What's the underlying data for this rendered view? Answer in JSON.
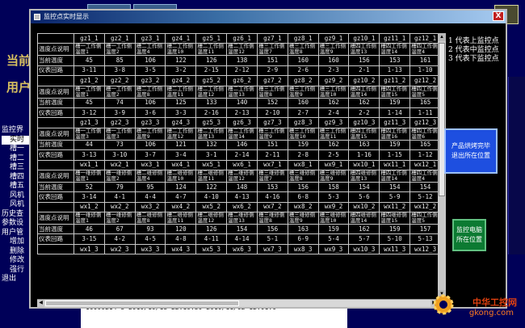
{
  "window": {
    "title": "监控点实时显示",
    "close_label": "X"
  },
  "legend": [
    "1 代表上监控点",
    "2 代表中监控点",
    "3 代表下监控点"
  ],
  "buttons": {
    "product_out": "产品烘烤完毕\n退出所在位置",
    "monitor_pc": "监控电脑\n所在位置"
  },
  "background": {
    "tree_items": [
      "监控界",
      "实时",
      "槽一",
      "槽二",
      "槽三",
      "槽四",
      "槽五",
      "风机",
      "风机",
      "历史查",
      "参数设",
      "用户管",
      "增加",
      "删除",
      "修改",
      "强行",
      "退出"
    ],
    "bottom_rows": [
      "10100103851   2010/11/04 12:01:25  2010/11/05 12:01:25",
      "10090214 8    2010/10/18 22:19:59  2010/11/02 12:01:0"
    ]
  },
  "watermark": {
    "brand": "中华工控网",
    "site": "gkong.com"
  },
  "grid": {
    "row_labels": {
      "desc": "温度点说明",
      "temp": "当前温度",
      "loop": "仪表回路"
    },
    "blocks": [
      {
        "headers": [
          "gz1_1",
          "gz2_1",
          "gz3_1",
          "gz4_1",
          "gz5_1",
          "gz6_1",
          "gz7_1",
          "gz8_1",
          "gz9_1",
          "gz10_1",
          "gz11_1",
          "gz12_1"
        ],
        "desc": [
          "槽一工作侧温度1",
          "槽一工作侧温度2",
          "槽二工作侧温度4",
          "槽二工作侧温度10",
          "槽二工作侧温度11",
          "槽二工作侧温度12",
          "槽三工作侧温度7",
          "槽三工作侧温度8",
          "槽三工作侧温度9",
          "槽四工作侧温度13",
          "槽四工作侧温度14",
          "槽四工作侧温度4"
        ],
        "temp": [
          "45",
          "85",
          "106",
          "122",
          "126",
          "138",
          "151",
          "160",
          "160",
          "156",
          "153",
          "161"
        ],
        "loop": [
          "3-11",
          "3-8",
          "3-5",
          "3-2",
          "2-15",
          "2-12",
          "2-9",
          "2-6",
          "2-3",
          "2-1",
          "1-13",
          "1-10"
        ]
      },
      {
        "headers": [
          "gz1_2",
          "gz2_2",
          "gz3_2",
          "gz4_2",
          "gz5_2",
          "gz6_2",
          "gz7_2",
          "gz8_2",
          "gz9_2",
          "gz10_2",
          "gz11_2",
          "gz12_2"
        ],
        "desc": [
          "槽一工作侧温度1",
          "槽一工作侧温度2",
          "槽二工作侧温度8",
          "槽二工作侧温度11",
          "槽二工作侧温度12",
          "槽二工作侧温度13",
          "槽三工作侧温度8",
          "槽三工作侧温度9",
          "槽三工作侧温度10",
          "槽四工作侧温度14",
          "槽四工作侧温度15",
          "槽四工作侧温度5"
        ],
        "temp": [
          "45",
          "74",
          "106",
          "125",
          "133",
          "140",
          "152",
          "160",
          "162",
          "162",
          "159",
          "165"
        ],
        "loop": [
          "3-12",
          "3-9",
          "3-6",
          "3-3",
          "2-16",
          "2-13",
          "2-10",
          "2-7",
          "2-4",
          "2-2",
          "1-14",
          "1-11"
        ]
      },
      {
        "headers": [
          "gz1_3",
          "gz2_3",
          "gz3_3",
          "gz4_3",
          "gz5_3",
          "gz6_3",
          "gz7_3",
          "gz8_3",
          "gz9_3",
          "gz10_3",
          "gz11_3",
          "gz12_3"
        ],
        "desc": [
          "槽一工作侧温度3",
          "槽一工作侧温度3",
          "槽二工作侧温度9",
          "槽二工作侧温度12",
          "槽二工作侧温度13",
          "槽二工作侧温度14",
          "槽三工作侧温度9",
          "槽三工作侧温度10",
          "槽三工作侧温度11",
          "槽四工作侧温度15",
          "槽四工作侧温度16",
          "槽四工作侧温度6"
        ],
        "temp": [
          "44",
          "73",
          "106",
          "121",
          "132",
          "146",
          "151",
          "159",
          "162",
          "163",
          "159",
          "165"
        ],
        "loop": [
          "3-13",
          "3-10",
          "3-7",
          "3-4",
          "3-1",
          "2-14",
          "2-11",
          "2-8",
          "2-5",
          "1-16",
          "1-15",
          "1-12"
        ]
      },
      {
        "headers": [
          "wx1_1",
          "wx2_1",
          "wx3_1",
          "wx4_1",
          "wx5_1",
          "wx6_1",
          "wx7_1",
          "wx8_1",
          "wx9_1",
          "wx10_1",
          "wx11_1",
          "wx12_1"
        ],
        "desc": [
          "槽一维修侧温度1",
          "槽一维修侧温度2",
          "槽二维修侧温度4",
          "槽二维修侧温度10",
          "槽二维修侧温度11",
          "槽二维修侧温度12",
          "槽三维修侧温度7",
          "槽三维修侧温度8",
          "槽三维修侧温度9",
          "槽四维修侧温度13",
          "槽四工作侧温度14",
          "槽四工作侧温度4"
        ],
        "temp": [
          "52",
          "79",
          "95",
          "124",
          "122",
          "148",
          "153",
          "156",
          "158",
          "154",
          "154",
          "154"
        ],
        "loop": [
          "3-14",
          "4-1",
          "4-4",
          "4-7",
          "4-10",
          "4-13",
          "4-16",
          "6-8",
          "5-3",
          "5-6",
          "5-9",
          "5-12"
        ]
      },
      {
        "headers": [
          "wx1_2",
          "wx2_2",
          "wx3_2",
          "wx4_2",
          "wx5_2",
          "wx6_2",
          "wx7_2",
          "wx8_2",
          "wx9_2",
          "wx10_2",
          "wx11_2",
          "wx12_2"
        ],
        "desc": [
          "槽一维修侧温度1",
          "槽一维修侧温度2",
          "槽二维修侧温度8",
          "槽二维修侧温度11",
          "槽二维修侧温度12",
          "槽二维修侧温度13",
          "槽三维修侧温度8",
          "槽三维修侧温度9",
          "槽三维修侧温度10",
          "槽四维修侧温度14",
          "槽四维修侧温度15",
          "槽四工作侧温度5"
        ],
        "temp": [
          "46",
          "67",
          "93",
          "120",
          "126",
          "154",
          "156",
          "163",
          "159",
          "162",
          "159",
          "157"
        ],
        "loop": [
          "3-15",
          "4-2",
          "4-5",
          "4-8",
          "4-11",
          "4-14",
          "5-1",
          "6-9",
          "5-4",
          "5-7",
          "5-10",
          "5-13"
        ]
      },
      {
        "headers": [
          "wx1_3",
          "wx2_3",
          "wx3_3",
          "wx4_3",
          "wx5_3",
          "wx6_3",
          "wx7_3",
          "wx8_3",
          "wx9_3",
          "wx10_3",
          "wx11_3",
          "wx12_3"
        ]
      }
    ]
  }
}
